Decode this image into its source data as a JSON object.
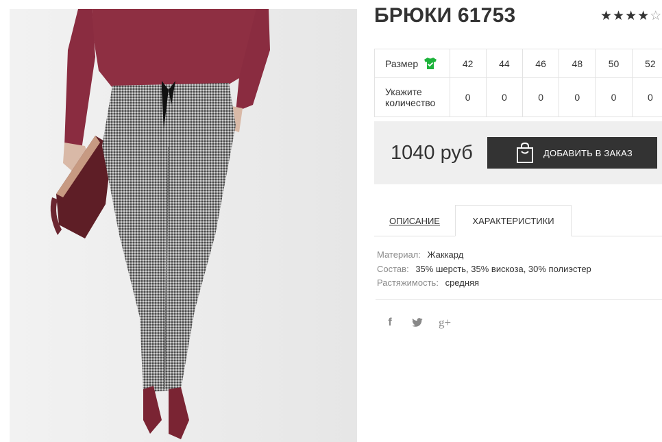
{
  "product": {
    "title": "БРЮКИ 61753",
    "rating": 4,
    "rating_max": 5
  },
  "sizes_table": {
    "size_label": "Размер",
    "quantity_label": "Укажите количество",
    "sizes": [
      "42",
      "44",
      "46",
      "48",
      "50",
      "52"
    ],
    "quantities": [
      "0",
      "0",
      "0",
      "0",
      "0",
      "0"
    ],
    "size_icon": "shirt-check-icon",
    "size_icon_color": "#1db33b"
  },
  "buy": {
    "price": "1040 руб",
    "add_button_label": "ДОБАВИТЬ В ЗАКАЗ",
    "add_button_icon": "shopping-bag-icon",
    "button_color": "#333333"
  },
  "tabs": {
    "description": "ОПИСАНИЕ",
    "characteristics": "ХАРАКТЕРИСТИКИ",
    "active": "characteristics"
  },
  "specs": [
    {
      "label": "Материал:",
      "value": "Жаккард"
    },
    {
      "label": "Состав:",
      "value": "35% шерсть, 35% вискоза, 30% полиэстер"
    },
    {
      "label": "Растяжимость:",
      "value": "средняя"
    }
  ],
  "social": {
    "facebook": "f",
    "twitter_icon": "twitter-icon",
    "googleplus": "g+"
  }
}
